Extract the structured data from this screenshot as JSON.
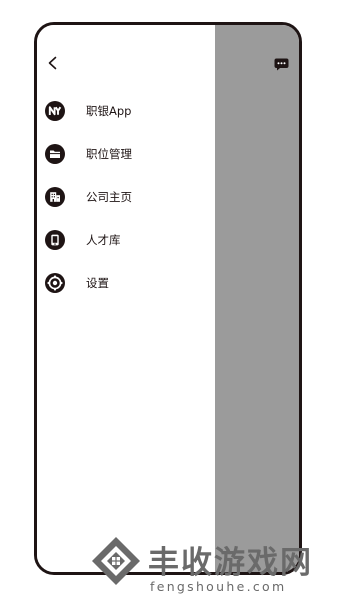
{
  "menu": {
    "items": [
      {
        "label": "职银App",
        "icon": "ny-logo-icon"
      },
      {
        "label": "职位管理",
        "icon": "folder-icon"
      },
      {
        "label": "公司主页",
        "icon": "building-icon"
      },
      {
        "label": "人才库",
        "icon": "phone-icon"
      },
      {
        "label": "设置",
        "icon": "gear-icon"
      }
    ]
  },
  "top_bar": {
    "back_icon": "chevron-left-icon",
    "chat_icon": "chat-bubble-icon"
  },
  "watermark": {
    "title": "丰收游戏网",
    "subtitle": "fengshouhe.com",
    "logo": "diamond-logo"
  },
  "colors": {
    "ink": "#1e1414",
    "scrim": "#9b9b9b",
    "watermark": "#6a6a6a"
  }
}
